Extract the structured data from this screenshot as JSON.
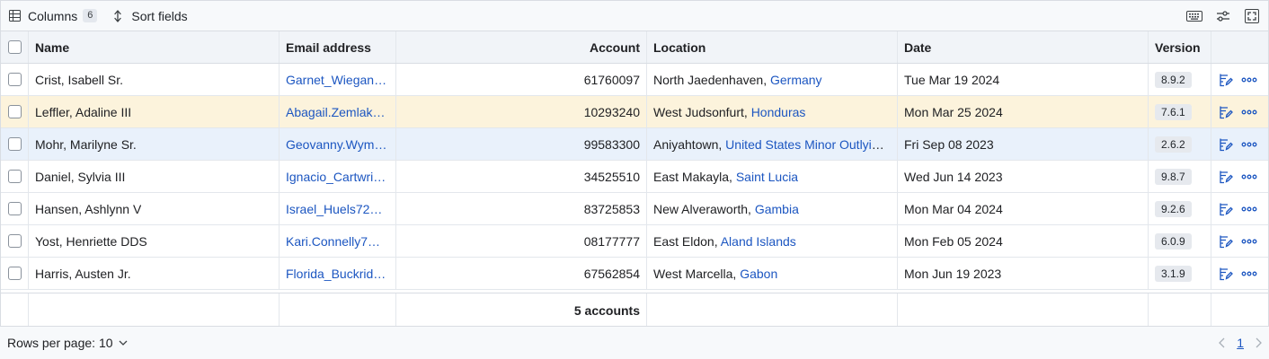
{
  "toolbar": {
    "columns_label": "Columns",
    "columns_count": "6",
    "sort_label": "Sort fields"
  },
  "columns": {
    "name": "Name",
    "email": "Email address",
    "account": "Account",
    "location": "Location",
    "date": "Date",
    "version": "Version"
  },
  "rows": [
    {
      "name": "Crist, Isabell Sr.",
      "email": "Garnet_Wiegand…",
      "account": "61760097",
      "city": "North Jaedenhaven, ",
      "country": "Germany",
      "date": "Tue Mar 19 2024",
      "version": "8.9.2",
      "highlight": "none"
    },
    {
      "name": "Leffler, Adaline III",
      "email": "Abagail.Zemlak…",
      "account": "10293240",
      "city": "West Judsonfurt, ",
      "country": "Honduras",
      "date": "Mon Mar 25 2024",
      "version": "7.6.1",
      "highlight": "warn"
    },
    {
      "name": "Mohr, Marilyne Sr.",
      "email": "Geovanny.Wyma…",
      "account": "99583300",
      "city": "Aniyahtown, ",
      "country": "United States Minor Outlying…",
      "date": "Fri Sep 08 2023",
      "version": "2.6.2",
      "highlight": "sel"
    },
    {
      "name": "Daniel, Sylvia III",
      "email": "Ignacio_Cartwri…",
      "account": "34525510",
      "city": "East Makayla, ",
      "country": "Saint Lucia",
      "date": "Wed Jun 14 2023",
      "version": "9.8.7",
      "highlight": "none"
    },
    {
      "name": "Hansen, Ashlynn V",
      "email": "Israel_Huels72…",
      "account": "83725853",
      "city": "New Alveraworth, ",
      "country": "Gambia",
      "date": "Mon Mar 04 2024",
      "version": "9.2.6",
      "highlight": "none"
    },
    {
      "name": "Yost, Henriette DDS",
      "email": "Kari.Connelly7…",
      "account": "08177777",
      "city": "East Eldon, ",
      "country": "Aland Islands",
      "date": "Mon Feb 05 2024",
      "version": "6.0.9",
      "highlight": "none"
    },
    {
      "name": "Harris, Austen Jr.",
      "email": "Florida_Buckrid…",
      "account": "67562854",
      "city": "West Marcella, ",
      "country": "Gabon",
      "date": "Mon Jun 19 2023",
      "version": "3.1.9",
      "highlight": "none"
    }
  ],
  "footer": {
    "accounts_total": "5 accounts"
  },
  "pager": {
    "rows_per_page": "Rows per page: 10",
    "current_page": "1"
  },
  "colors": {
    "link": "#1c56c1",
    "row_warn": "#fcf3dc",
    "row_selected": "#e9f1fb",
    "header_bg": "#f1f4f8"
  }
}
